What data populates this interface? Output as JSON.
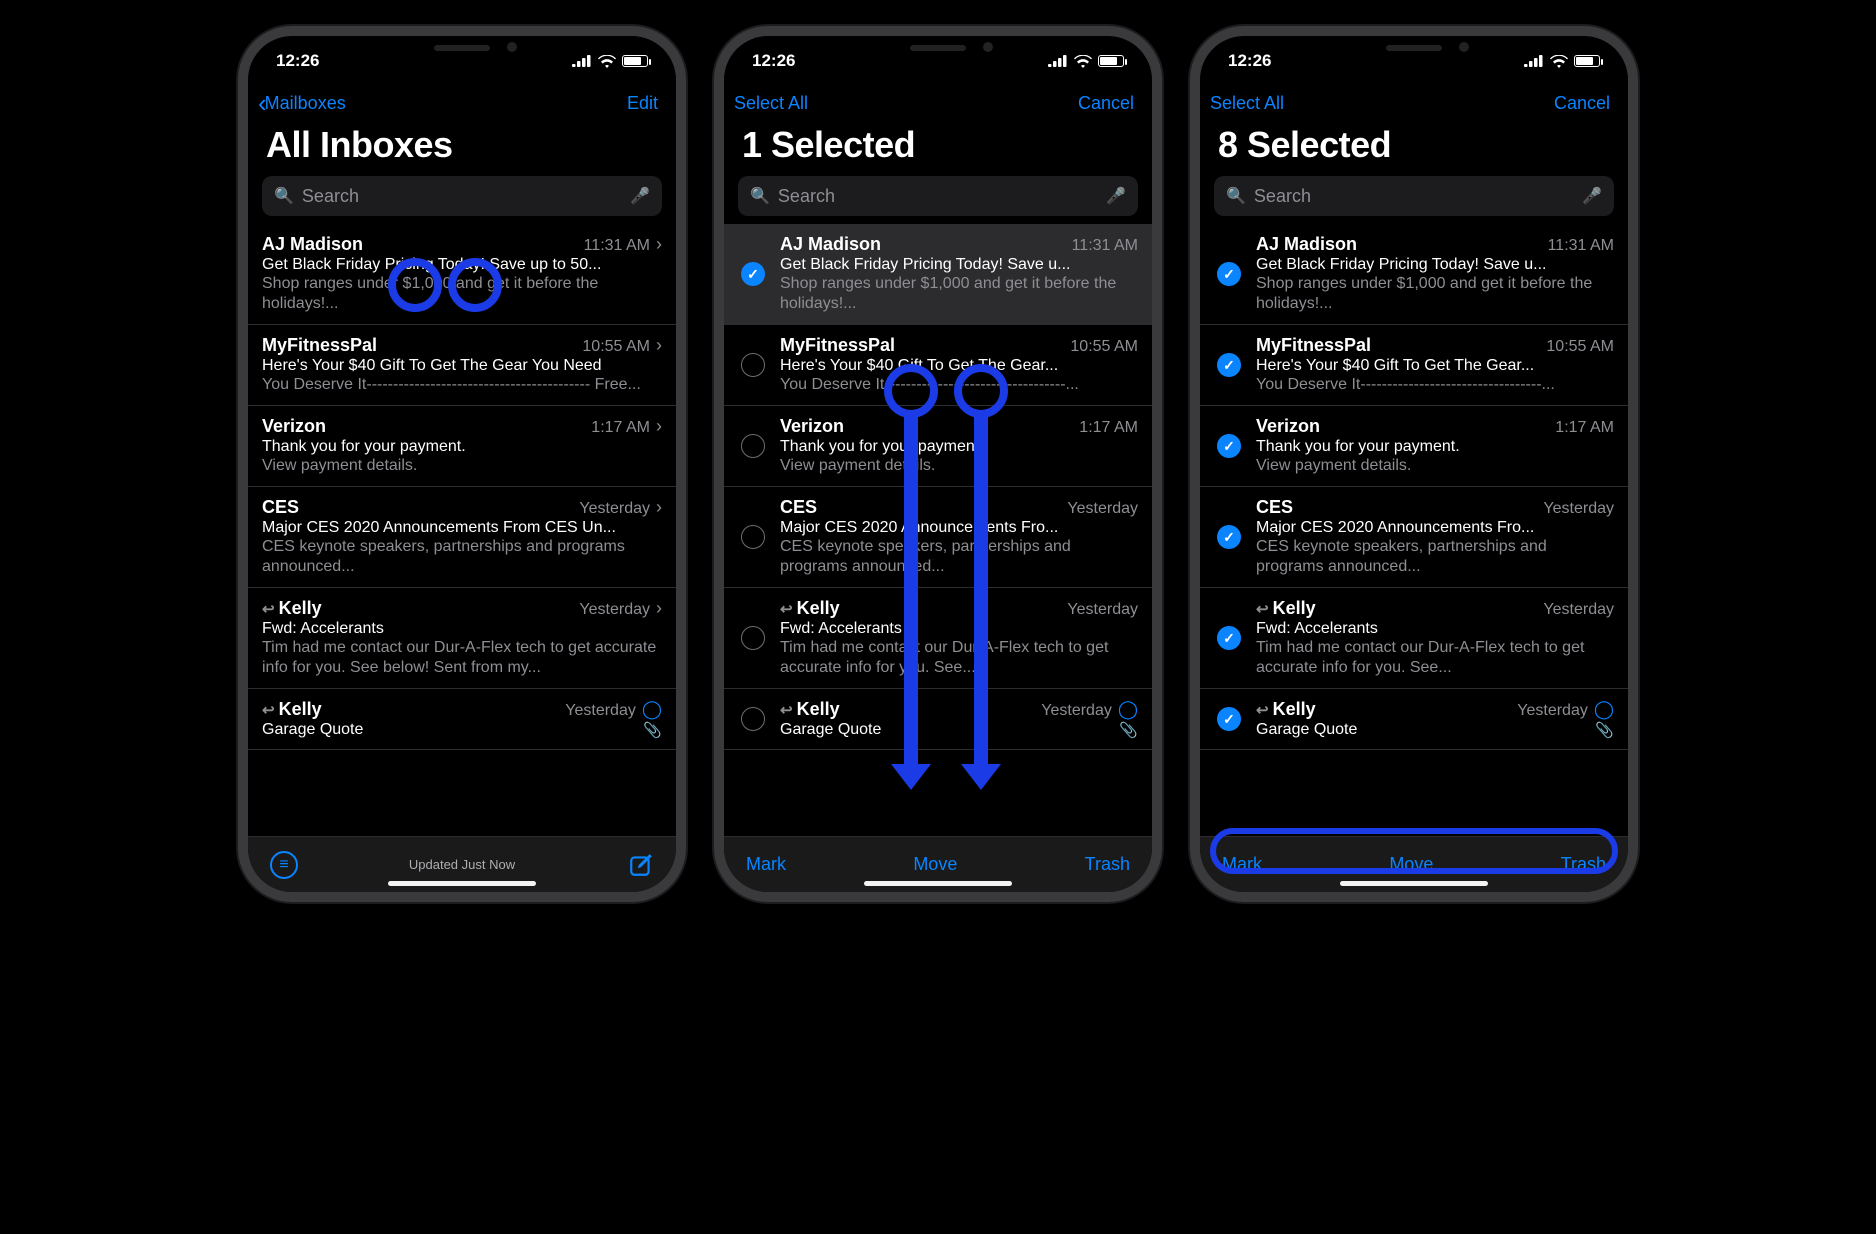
{
  "statusbar": {
    "time": "12:26"
  },
  "screens": [
    {
      "nav": {
        "back": "Mailboxes",
        "right": "Edit"
      },
      "title": "All Inboxes",
      "search_placeholder": "Search",
      "select_mode": false,
      "toolbar": {
        "type": "browse",
        "status": "Updated Just Now"
      },
      "overlay": "tap",
      "emails": [
        {
          "selected": null,
          "reply": false,
          "sender": "AJ Madison",
          "time": "11:31 AM",
          "disc": "chev",
          "subject": "Get Black Friday Pricing Today! Save up to 50...",
          "preview": "Shop ranges under $1,000 and get it before the holidays!...",
          "attach": false
        },
        {
          "selected": null,
          "reply": false,
          "sender": "MyFitnessPal",
          "time": "10:55 AM",
          "disc": "chev",
          "subject": "Here's Your $40 Gift To Get The Gear You Need",
          "preview": "You Deserve It------------------------------------------ Free...",
          "attach": false
        },
        {
          "selected": null,
          "reply": false,
          "sender": "Verizon",
          "time": "1:17 AM",
          "disc": "chev",
          "subject": "Thank you for your payment.",
          "preview": "View payment details.",
          "attach": false
        },
        {
          "selected": null,
          "reply": false,
          "sender": "CES",
          "time": "Yesterday",
          "disc": "chev",
          "subject": "Major CES 2020 Announcements From CES Un...",
          "preview": "CES keynote speakers, partnerships and programs announced...",
          "attach": false
        },
        {
          "selected": null,
          "reply": true,
          "sender": "Kelly",
          "time": "Yesterday",
          "disc": "chev",
          "subject": "Fwd: Accelerants",
          "preview": "Tim had me contact our Dur-A-Flex tech to get accurate info for you. See below! Sent from my...",
          "attach": false
        },
        {
          "selected": null,
          "reply": true,
          "sender": "Kelly",
          "time": "Yesterday",
          "disc": "blue",
          "subject": "Garage Quote",
          "preview": "",
          "attach": true
        }
      ]
    },
    {
      "nav": {
        "back": "Select All",
        "right": "Cancel"
      },
      "title": "1 Selected",
      "search_placeholder": "Search",
      "select_mode": true,
      "toolbar": {
        "type": "edit",
        "left": "Mark",
        "mid": "Move",
        "right": "Trash"
      },
      "overlay": "drag",
      "emails": [
        {
          "selected": true,
          "highlight": true,
          "reply": false,
          "sender": "AJ Madison",
          "time": "11:31 AM",
          "disc": "",
          "subject": "Get Black Friday Pricing Today! Save u...",
          "preview": "Shop ranges under $1,000 and get it before the holidays!...",
          "attach": false
        },
        {
          "selected": false,
          "reply": false,
          "sender": "MyFitnessPal",
          "time": "10:55 AM",
          "disc": "",
          "subject": "Here's Your $40 Gift To Get The Gear...",
          "preview": "You Deserve It----------------------------------...",
          "attach": false
        },
        {
          "selected": false,
          "reply": false,
          "sender": "Verizon",
          "time": "1:17 AM",
          "disc": "",
          "subject": "Thank you for your payment.",
          "preview": "View payment details.",
          "attach": false
        },
        {
          "selected": false,
          "reply": false,
          "sender": "CES",
          "time": "Yesterday",
          "disc": "",
          "subject": "Major CES 2020 Announcements Fro...",
          "preview": "CES keynote speakers, partnerships and programs announced...",
          "attach": false
        },
        {
          "selected": false,
          "reply": true,
          "sender": "Kelly",
          "time": "Yesterday",
          "disc": "",
          "subject": "Fwd: Accelerants",
          "preview": "Tim had me contact our Dur-A-Flex tech to get accurate info for you. See...",
          "attach": false
        },
        {
          "selected": false,
          "reply": true,
          "sender": "Kelly",
          "time": "Yesterday",
          "disc": "blue",
          "subject": "Garage Quote",
          "preview": "",
          "attach": true
        }
      ]
    },
    {
      "nav": {
        "back": "Select All",
        "right": "Cancel"
      },
      "title": "8 Selected",
      "search_placeholder": "Search",
      "select_mode": true,
      "toolbar": {
        "type": "edit",
        "left": "Mark",
        "mid": "Move",
        "right": "Trash"
      },
      "overlay": "toolbar-ring",
      "emails": [
        {
          "selected": true,
          "reply": false,
          "sender": "AJ Madison",
          "time": "11:31 AM",
          "disc": "",
          "subject": "Get Black Friday Pricing Today! Save u...",
          "preview": "Shop ranges under $1,000 and get it before the holidays!...",
          "attach": false
        },
        {
          "selected": true,
          "reply": false,
          "sender": "MyFitnessPal",
          "time": "10:55 AM",
          "disc": "",
          "subject": "Here's Your $40 Gift To Get The Gear...",
          "preview": "You Deserve It----------------------------------...",
          "attach": false
        },
        {
          "selected": true,
          "reply": false,
          "sender": "Verizon",
          "time": "1:17 AM",
          "disc": "",
          "subject": "Thank you for your payment.",
          "preview": "View payment details.",
          "attach": false
        },
        {
          "selected": true,
          "reply": false,
          "sender": "CES",
          "time": "Yesterday",
          "disc": "",
          "subject": "Major CES 2020 Announcements Fro...",
          "preview": "CES keynote speakers, partnerships and programs announced...",
          "attach": false
        },
        {
          "selected": true,
          "reply": true,
          "sender": "Kelly",
          "time": "Yesterday",
          "disc": "",
          "subject": "Fwd: Accelerants",
          "preview": "Tim had me contact our Dur-A-Flex tech to get accurate info for you. See...",
          "attach": false
        },
        {
          "selected": true,
          "reply": true,
          "sender": "Kelly",
          "time": "Yesterday",
          "disc": "blue",
          "subject": "Garage Quote",
          "preview": "",
          "attach": true
        }
      ]
    }
  ]
}
